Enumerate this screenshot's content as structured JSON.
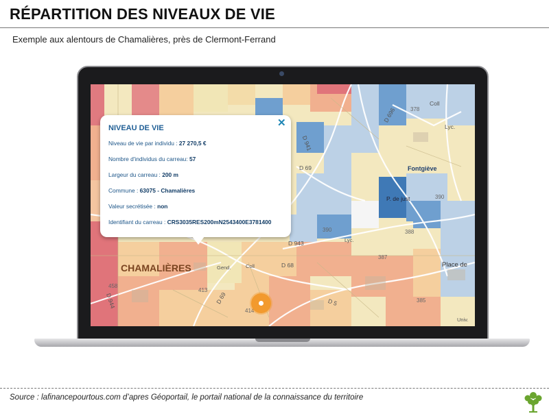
{
  "header": {
    "title": "RÉPARTITION DES NIVEAUX DE VIE",
    "subtitle": "Exemple aux alentours de Chamalières, près de Clermont-Ferrand"
  },
  "popup": {
    "title": "NIVEAU DE VIE",
    "close_glyph": "✕",
    "rows": [
      {
        "label": "Niveau de vie par individu : ",
        "value": "27 270,5 €"
      },
      {
        "label": "Nombre d'individus du carreau: ",
        "value": "57"
      },
      {
        "label": "Largeur du carreau : ",
        "value": "200 m"
      },
      {
        "label": "Commune : ",
        "value": "63075 - Chamalières"
      },
      {
        "label": "Valeur secrétisée : ",
        "value": "non"
      },
      {
        "label": "Identifiant du carreau : ",
        "value": "CRS3035RES200mN2543400E3781400"
      }
    ]
  },
  "map": {
    "places": {
      "chamalieres": "CHAMALIÈRES",
      "fontgieve": "Fontgiève",
      "place_de": "Place de",
      "p_de_jus": "P. de just",
      "lyc": "Lyc.",
      "coll": "Coll",
      "univ": "Univ.",
      "gend": "Gend.",
      "lyc2": "Lyc."
    },
    "roads": {
      "d941": "D 941",
      "d69": "D 69",
      "d696": "D 696",
      "d943": "D 943",
      "d68": "D 68",
      "d69b": "D 69",
      "d944": "D 944",
      "d5": "D 5",
      "coll2": "Coll"
    },
    "numbers": {
      "n378": "378",
      "n390": "390",
      "n390b": "390",
      "n387": "387",
      "n385": "385",
      "n413": "413",
      "n458": "458",
      "n414": "414",
      "n388": "388"
    },
    "colors": {
      "red": "#e0747a",
      "salmon": "#f1b08f",
      "light_orange": "#f5cf9e",
      "cream": "#f1e6b6",
      "light_blue": "#bcd1e6",
      "blue": "#6f9fcf",
      "dark_blue": "#3f79b6",
      "marker": "#f29a2e"
    }
  },
  "footer": {
    "source": "Source : lafinancepourtous.com d’apres Géoportail, le portail national de la connaissance du territoire",
    "logo_icon": "tree-icon"
  }
}
